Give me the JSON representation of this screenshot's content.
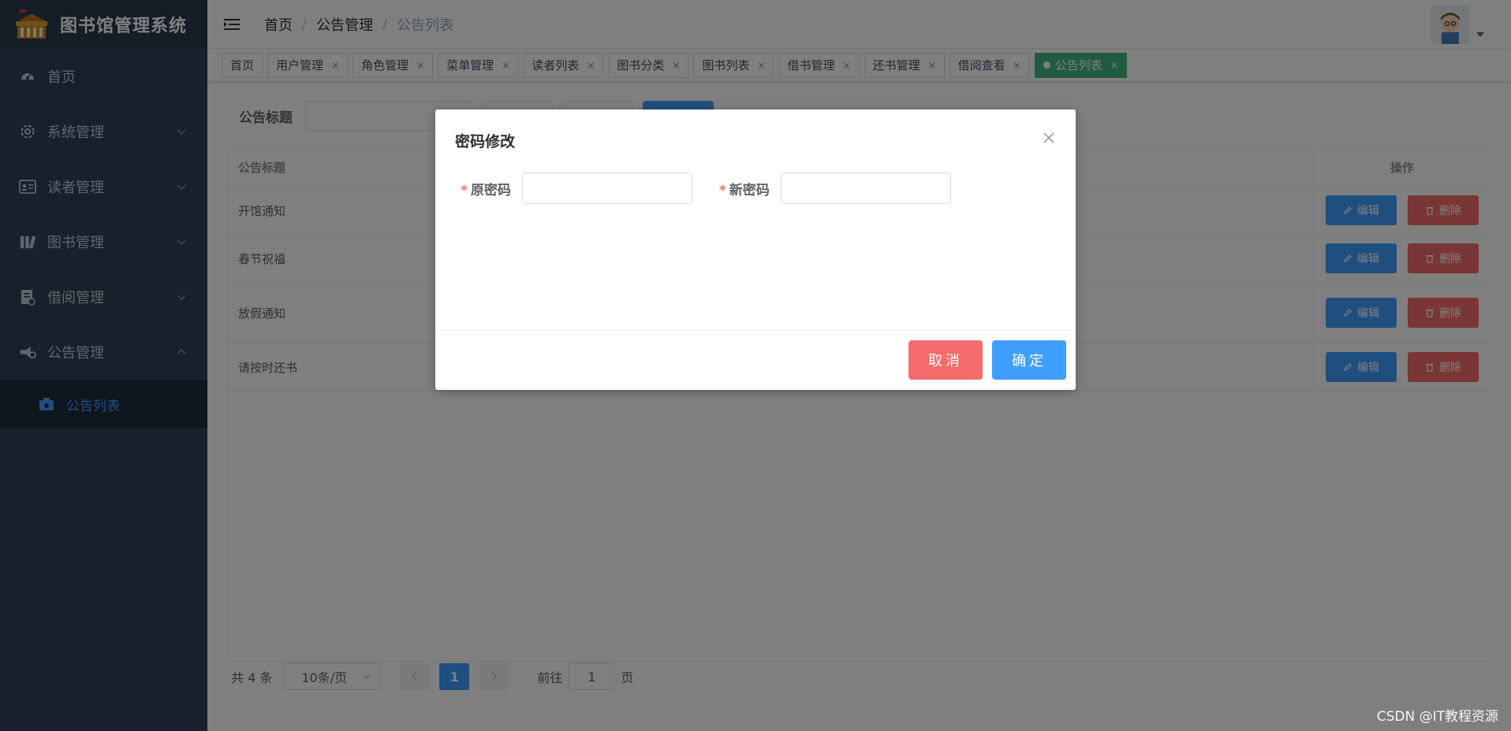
{
  "app": {
    "title": "图书馆管理系统",
    "accent": "#409eff",
    "sidebar_bg": "#304156"
  },
  "sidebar": {
    "items": [
      {
        "label": "首页",
        "icon": "dashboard-icon"
      },
      {
        "label": "系统管理",
        "icon": "gear-icon"
      },
      {
        "label": "读者管理",
        "icon": "id-card-icon"
      },
      {
        "label": "图书管理",
        "icon": "books-icon"
      },
      {
        "label": "借阅管理",
        "icon": "borrow-icon"
      },
      {
        "label": "公告管理",
        "icon": "announcement-icon"
      }
    ],
    "submenu": {
      "label": "公告列表",
      "icon": "notice-list-icon"
    }
  },
  "header": {
    "breadcrumb": [
      "首页",
      "公告管理",
      "公告列表"
    ]
  },
  "tags": [
    {
      "label": "首页",
      "closable": false
    },
    {
      "label": "用户管理",
      "closable": true
    },
    {
      "label": "角色管理",
      "closable": true
    },
    {
      "label": "菜单管理",
      "closable": true
    },
    {
      "label": "读者列表",
      "closable": true
    },
    {
      "label": "图书分类",
      "closable": true
    },
    {
      "label": "图书列表",
      "closable": true
    },
    {
      "label": "借书管理",
      "closable": true
    },
    {
      "label": "还书管理",
      "closable": true
    },
    {
      "label": "借阅查看",
      "closable": true
    },
    {
      "label": "公告列表",
      "closable": true,
      "active": true
    }
  ],
  "tag_close": "×",
  "search": {
    "label": "公告标题"
  },
  "table": {
    "headers": {
      "title": "公告标题",
      "ops": "操作"
    },
    "rows": [
      {
        "title": "开馆通知"
      },
      {
        "title": "春节祝福"
      },
      {
        "title": "放假通知"
      },
      {
        "title": "请按时还书"
      }
    ],
    "edit_label": "编辑",
    "delete_label": "删除"
  },
  "pager": {
    "total": "共 4 条",
    "size": "10条/页",
    "current": "1",
    "goto_prefix": "前往",
    "goto_value": "1",
    "goto_suffix": "页"
  },
  "dialog": {
    "title": "密码修改",
    "old_label": "原密码",
    "new_label": "新密码",
    "required_mark": "*",
    "cancel": "取消",
    "confirm": "确定"
  },
  "watermark": "CSDN @IT教程资源"
}
